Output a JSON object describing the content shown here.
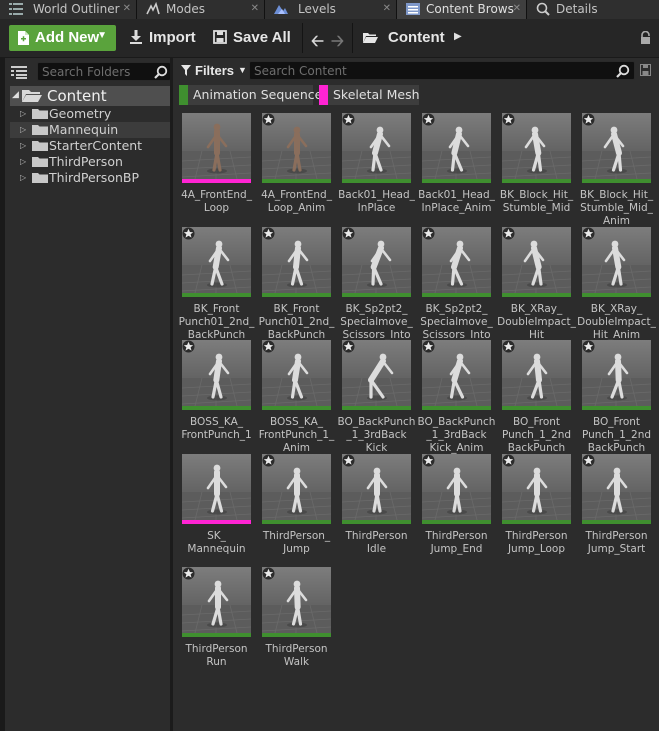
{
  "tabs": [
    {
      "label": "World Outliner",
      "icon": "list-icon",
      "active": false
    },
    {
      "label": "Modes",
      "icon": "modes-icon",
      "active": false
    },
    {
      "label": "Levels",
      "icon": "levels-icon",
      "active": false
    },
    {
      "label": "Content Brows",
      "icon": "content-browser-icon",
      "active": true
    },
    {
      "label": "Details",
      "icon": "details-icon",
      "active": false
    }
  ],
  "toolbar": {
    "add_new_label": "Add New",
    "import_label": "Import",
    "save_all_label": "Save All",
    "breadcrumb": "Content"
  },
  "left_panel": {
    "search_placeholder": "Search Folders",
    "root": "Content",
    "folders": [
      {
        "label": "Geometry",
        "selected": false
      },
      {
        "label": "Mannequin",
        "selected": true
      },
      {
        "label": "StarterContent",
        "selected": false
      },
      {
        "label": "ThirdPerson",
        "selected": false
      },
      {
        "label": "ThirdPersonBP",
        "selected": false
      }
    ]
  },
  "right_panel": {
    "filters_label": "Filters",
    "search_placeholder": "Search Content",
    "filter_chips": [
      {
        "label": "Animation Sequence",
        "color": "#3f8f2f"
      },
      {
        "label": "Skeletal Mesh",
        "color": "#ff24d3"
      }
    ]
  },
  "colors": {
    "animation": "#3f8f2f",
    "skeletal": "#ff24d3",
    "add_new": "#5aa33c"
  },
  "assets": [
    {
      "name": "4A_FrontEnd_\nLoop",
      "type": "skeletal"
    },
    {
      "name": "4A_FrontEnd_\nLoop_Anim",
      "type": "animation"
    },
    {
      "name": "Back01_Head_\nInPlace",
      "type": "animation"
    },
    {
      "name": "Back01_Head_\nInPlace_Anim",
      "type": "animation"
    },
    {
      "name": "BK_Block_Hit_\nStumble_Mid",
      "type": "animation"
    },
    {
      "name": "BK_Block_Hit_\nStumble_Mid_\nAnim",
      "type": "animation"
    },
    {
      "name": "BK_Front\nPunch01_2nd_\nBackPunch",
      "type": "animation"
    },
    {
      "name": "BK_Front\nPunch01_2nd_\nBackPunch",
      "type": "animation"
    },
    {
      "name": "BK_Sp2pt2_\nSpecialmove_\nScissors_Into",
      "type": "animation"
    },
    {
      "name": "BK_Sp2pt2_\nSpecialmove_\nScissors_Into",
      "type": "animation"
    },
    {
      "name": "BK_XRay_\nDoubleImpact_\nHit",
      "type": "animation"
    },
    {
      "name": "BK_XRay_\nDoubleImpact_\nHit_Anim",
      "type": "animation"
    },
    {
      "name": "BOSS_KA_\nFrontPunch_1",
      "type": "animation"
    },
    {
      "name": "BOSS_KA_\nFrontPunch_1_\nAnim",
      "type": "animation"
    },
    {
      "name": "BO_BackPunch\n_1_3rdBack\nKick",
      "type": "animation"
    },
    {
      "name": "BO_BackPunch\n_1_3rdBack\nKick_Anim",
      "type": "animation"
    },
    {
      "name": "BO_Front\nPunch_1_2nd\nBackPunch",
      "type": "animation"
    },
    {
      "name": "BO_Front\nPunch_1_2nd\nBackPunch",
      "type": "animation"
    },
    {
      "name": "SK_\nMannequin",
      "type": "skeletal"
    },
    {
      "name": "ThirdPerson_\nJump",
      "type": "animation"
    },
    {
      "name": "ThirdPerson\nIdle",
      "type": "animation"
    },
    {
      "name": "ThirdPerson\nJump_End",
      "type": "animation"
    },
    {
      "name": "ThirdPerson\nJump_Loop",
      "type": "animation"
    },
    {
      "name": "ThirdPerson\nJump_Start",
      "type": "animation"
    },
    {
      "name": "ThirdPerson\nRun",
      "type": "animation"
    },
    {
      "name": "ThirdPerson\nWalk",
      "type": "animation"
    }
  ]
}
